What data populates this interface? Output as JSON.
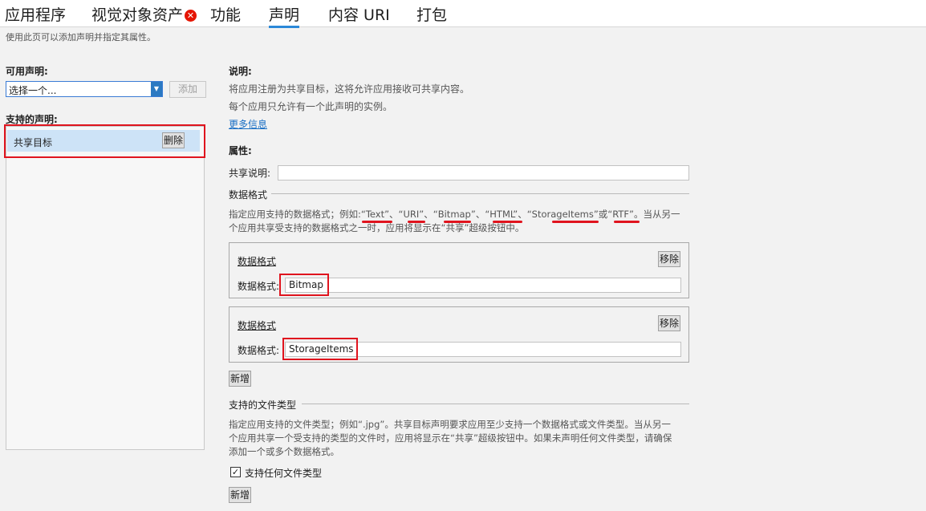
{
  "tabs": [
    {
      "label": "应用程序"
    },
    {
      "label": "视觉对象资产"
    },
    {
      "label": "功能"
    },
    {
      "label": "声明"
    },
    {
      "label": "内容 URI"
    },
    {
      "label": "打包"
    }
  ],
  "active_tab": "声明",
  "page_subtitle": "使用此页可以添加声明并指定其属性。",
  "left": {
    "available_label": "可用声明:",
    "select_value": "选择一个...",
    "add_label": "添加",
    "supported_label": "支持的声明:",
    "declarations": [
      {
        "name": "共享目标",
        "remove_label": "删除"
      }
    ]
  },
  "right": {
    "desc_title": "说明:",
    "desc_line1": "将应用注册为共享目标，这将允许应用接收可共享内容。",
    "desc_line2": "每个应用只允许有一个此声明的实例。",
    "more_info": "更多信息",
    "props_title": "属性:",
    "share_desc_label": "共享说明:",
    "share_desc_value": "",
    "data_formats_section": "数据格式",
    "data_formats_help1": "指定应用支持的数据格式；例如:“Text”、“URI”、“Bitmap”、“HTML”、“StorageItems”或“RTF”。当从另一",
    "data_formats_help2": "个应用共享受支持的数据格式之一时，应用将显示在“共享”超级按钮中。",
    "data_formats": [
      {
        "header": "数据格式",
        "remove_label": "移除",
        "field_label": "数据格式:",
        "value": "Bitmap"
      },
      {
        "header": "数据格式",
        "remove_label": "移除",
        "field_label": "数据格式:",
        "value": "StorageItems"
      }
    ],
    "new_label": "新增",
    "file_types_section": "支持的文件类型",
    "file_types_help1": "指定应用支持的文件类型；例如“.jpg”。共享目标声明要求应用至少支持一个数据格式或文件类型。当从另一",
    "file_types_help2": "个应用共享一个受支持的类型的文件时，应用将显示在“共享”超级按钮中。如果未声明任何文件类型，请确保",
    "file_types_help3": "添加一个或多个数据格式。",
    "any_file_type_label": "支持任何文件类型",
    "any_file_type_checked": "✓",
    "new_label2": "新增"
  },
  "colors": {
    "accent": "#2b88d8",
    "highlight": "#cde3f7",
    "annotation_red": "#e0141e",
    "error": "#e51400"
  }
}
